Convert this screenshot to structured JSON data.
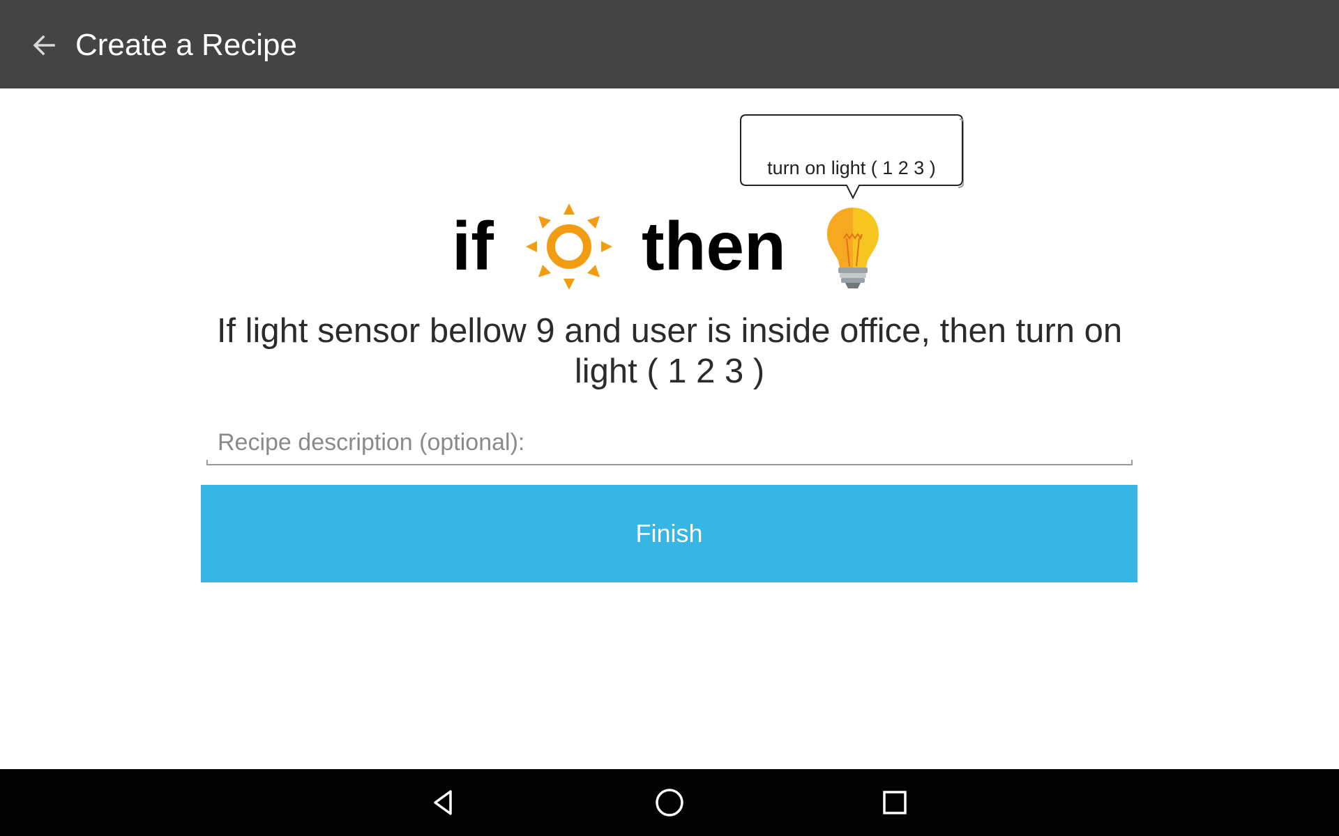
{
  "appbar": {
    "title": "Create a Recipe",
    "background": "#444444"
  },
  "rule": {
    "if_word": "if",
    "then_word": "then",
    "trigger_icon": "sun-icon",
    "action_icon": "light-bulb-icon",
    "action_tooltip": "turn on light ( 1 2 3 )"
  },
  "summary": {
    "text": "If light sensor bellow 9 and user is inside office, then turn on light ( 1 2 3 )"
  },
  "description": {
    "value": "",
    "placeholder": "Recipe description (optional):"
  },
  "finish": {
    "label": "Finish",
    "color": "#37b5e4"
  },
  "navbar": {
    "back": "nav-back-icon",
    "home": "nav-home-icon",
    "recents": "nav-recents-icon"
  }
}
